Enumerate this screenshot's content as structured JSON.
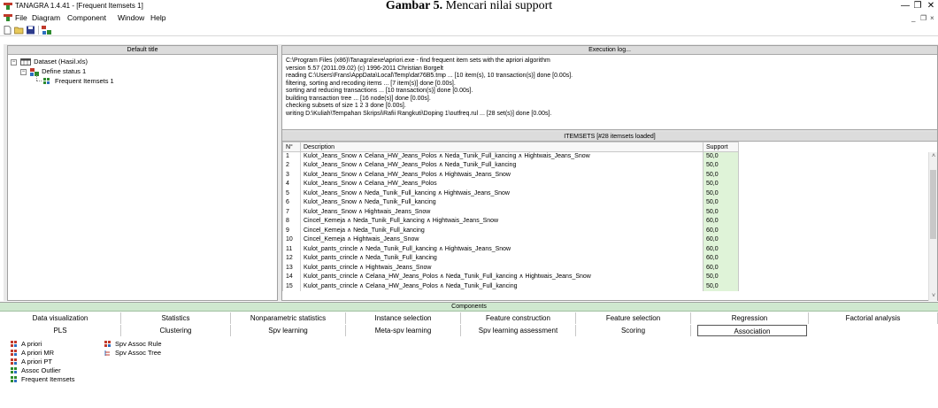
{
  "document_caption": {
    "bold": "Gambar 5.",
    "rest": " Mencari nilai support"
  },
  "window": {
    "title": "TANAGRA 1.4.41 - [Frequent Itemsets 1]",
    "minimize": "—",
    "restore": "❐",
    "close": "✕",
    "mdi_min": "_",
    "mdi_restore": "❐",
    "mdi_close": "×"
  },
  "menu": [
    "File",
    "Diagram",
    "Component",
    "Window",
    "Help"
  ],
  "toolbar": {
    "icons": [
      "new-file-icon",
      "open-folder-icon",
      "save-disk-icon",
      "diagram-icon"
    ]
  },
  "left_panel": {
    "header": "Default title",
    "tree": [
      {
        "label": "Dataset (Hasil.xls)",
        "level": 0,
        "toggle": "−",
        "icon": "dataset-table-icon"
      },
      {
        "label": "Define status 1",
        "level": 1,
        "toggle": "−",
        "icon": "define-status-icon"
      },
      {
        "label": "Frequent Itemsets 1",
        "level": 2,
        "toggle": "",
        "icon": "frequent-itemsets-icon"
      }
    ]
  },
  "exec_log": {
    "header": "Execution log...",
    "lines": [
      "C:\\Program Files (x86)\\Tanagra\\exe\\apriori.exe - find frequent item sets with the apriori algorithm",
      "version 5.57 (2011.09.02)      (c) 1996-2011   Christian Borgelt",
      "reading C:\\Users\\Frans\\AppData\\Local\\Temp\\dat76B5.tmp ... [10 item(s), 10 transaction(s)] done [0.00s].",
      "filtering, sorting and recoding items ... [7 item(s)] done [0.00s].",
      "sorting and reducing transactions ... [10 transaction(s)] done [0.00s].",
      "building transaction tree ... [16 node(s)] done [0.00s].",
      "checking subsets of size 1 2 3 done [0.00s].",
      "writing D:\\Kuliah\\Tempahan Skripsi\\Rafii Rangkuti\\Doping 1\\outfreq.rul ... [28 set(s)] done [0.00s]."
    ]
  },
  "itemsets": {
    "header": "ITEMSETS [#28 itemsets loaded]",
    "columns": [
      "N°",
      "Description",
      "Support"
    ],
    "rows": [
      [
        "1",
        "Kulot_Jeans_Snow ∧ Celana_HW_Jeans_Polos ∧ Neda_Tunik_Full_kancing ∧ Hightwais_Jeans_Snow",
        "50,0"
      ],
      [
        "2",
        "Kulot_Jeans_Snow ∧ Celana_HW_Jeans_Polos ∧ Neda_Tunik_Full_kancing",
        "50,0"
      ],
      [
        "3",
        "Kulot_Jeans_Snow ∧ Celana_HW_Jeans_Polos ∧ Hightwais_Jeans_Snow",
        "50,0"
      ],
      [
        "4",
        "Kulot_Jeans_Snow ∧ Celana_HW_Jeans_Polos",
        "50,0"
      ],
      [
        "5",
        "Kulot_Jeans_Snow ∧ Neda_Tunik_Full_kancing ∧ Hightwais_Jeans_Snow",
        "50,0"
      ],
      [
        "6",
        "Kulot_Jeans_Snow ∧ Neda_Tunik_Full_kancing",
        "50,0"
      ],
      [
        "7",
        "Kulot_Jeans_Snow ∧ Hightwais_Jeans_Snow",
        "50,0"
      ],
      [
        "8",
        "Cincel_Kemeja ∧ Neda_Tunik_Full_kancing ∧ Hightwais_Jeans_Snow",
        "60,0"
      ],
      [
        "9",
        "Cincel_Kemeja ∧ Neda_Tunik_Full_kancing",
        "60,0"
      ],
      [
        "10",
        "Cincel_Kemeja ∧ Hightwais_Jeans_Snow",
        "60,0"
      ],
      [
        "11",
        "Kulot_pants_crincle ∧ Neda_Tunik_Full_kancing ∧ Hightwais_Jeans_Snow",
        "60,0"
      ],
      [
        "12",
        "Kulot_pants_crincle ∧ Neda_Tunik_Full_kancing",
        "60,0"
      ],
      [
        "13",
        "Kulot_pants_crincle ∧ Hightwais_Jeans_Snow",
        "60,0"
      ],
      [
        "14",
        "Kulot_pants_crincle ∧ Celana_HW_Jeans_Polos ∧ Neda_Tunik_Full_kancing ∧ Hightwais_Jeans_Snow",
        "50,0"
      ],
      [
        "15",
        "Kulot_pants_crincle ∧ Celana_HW_Jeans_Polos ∧ Neda_Tunik_Full_kancing",
        "50,0"
      ]
    ],
    "scroll_up": "˄",
    "scroll_down": "˅"
  },
  "components": {
    "header": "Components",
    "tabs_row1": [
      "Data visualization",
      "Statistics",
      "Nonparametric statistics",
      "Instance selection",
      "Feature construction",
      "Feature selection",
      "Regression",
      "Factorial analysis"
    ],
    "tabs_row2": [
      "PLS",
      "Clustering",
      "Spv learning",
      "Meta-spv learning",
      "Spv learning assessment",
      "Scoring",
      "Association"
    ],
    "active_tab": "Association",
    "items_col1": [
      "A priori",
      "A priori MR",
      "A priori PT",
      "Assoc Outlier",
      "Frequent Itemsets"
    ],
    "items_col2": [
      "Spv Assoc Rule",
      "Spv Assoc Tree"
    ]
  },
  "colors": {
    "support_bg": "#dff3d8",
    "components_header": "#cfe8cf",
    "tanagra_red": "#c0392b",
    "tanagra_green": "#2e8b2e"
  }
}
